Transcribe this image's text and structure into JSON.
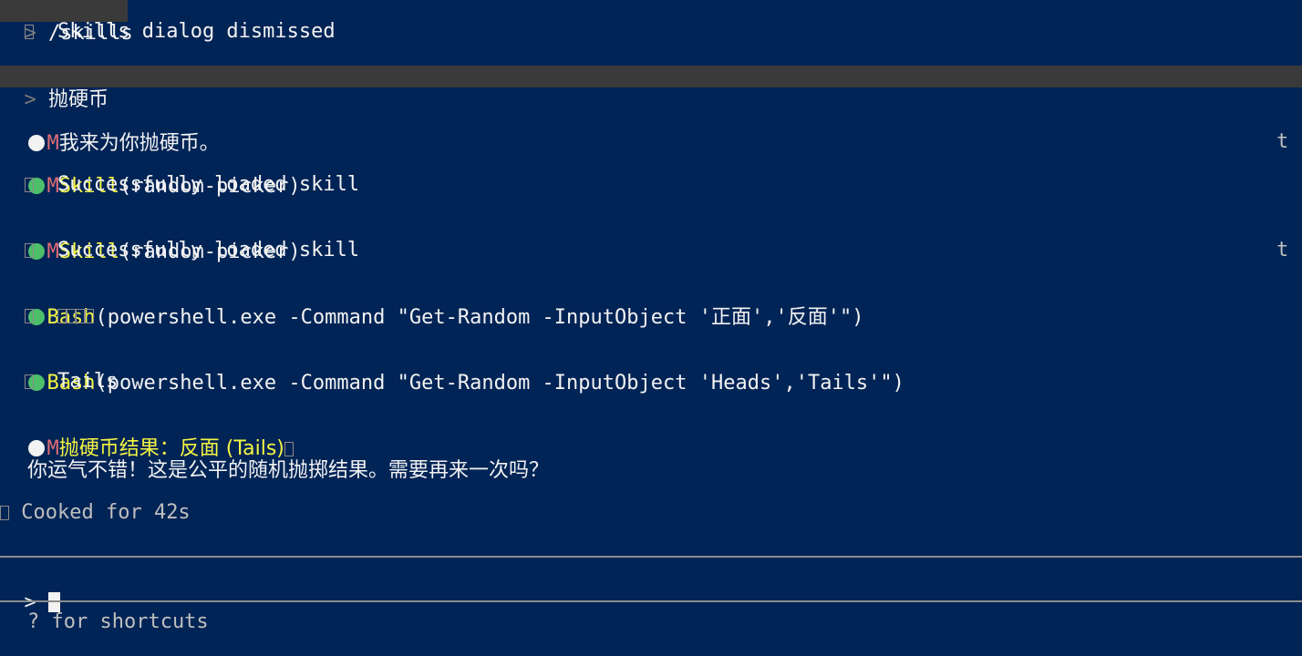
{
  "colors": {
    "background": "#012456",
    "text": "#f2f2f2",
    "accent_m": "#e06c75",
    "tool_name": "#f5f543",
    "status_dot_green": "#4dbf6a",
    "input_highlight": "#3a3a3a"
  },
  "transcript": {
    "cmd1": {
      "prompt": ">",
      "text": "/skills",
      "result_text": "Skills dialog dismissed"
    },
    "cmd2": {
      "prompt": ">",
      "text": "抛硬币"
    },
    "msg1": {
      "marker": "M",
      "text": "我来为你抛硬币。"
    },
    "skill1": {
      "marker": "M",
      "tool": "Skill",
      "args": "(random-picker)",
      "result_text": "Successfully loaded skill"
    },
    "skill2": {
      "marker": "M",
      "tool": "Skill",
      "args": "(random-picker)",
      "result_text": "Successfully loaded skill"
    },
    "bash1": {
      "tool": "Bash",
      "args": "(powershell.exe -Command \"Get-Random -InputObject '正面','反面'\")"
    },
    "bash2": {
      "tool": "Bash",
      "args": "(powershell.exe -Command \"Get-Random -InputObject 'Heads','Tails'\")",
      "result_text": "Tails"
    },
    "result": {
      "marker": "M",
      "headline": "抛硬币结果：反面 (Tails)",
      "body": "你运气不错！这是公平的随机抛掷结果。需要再来一次吗？"
    },
    "status": {
      "text": "Cooked for 42s"
    },
    "right_marks": [
      "t",
      "t"
    ]
  },
  "input": {
    "prompt": ">",
    "hint": "? for shortcuts"
  }
}
